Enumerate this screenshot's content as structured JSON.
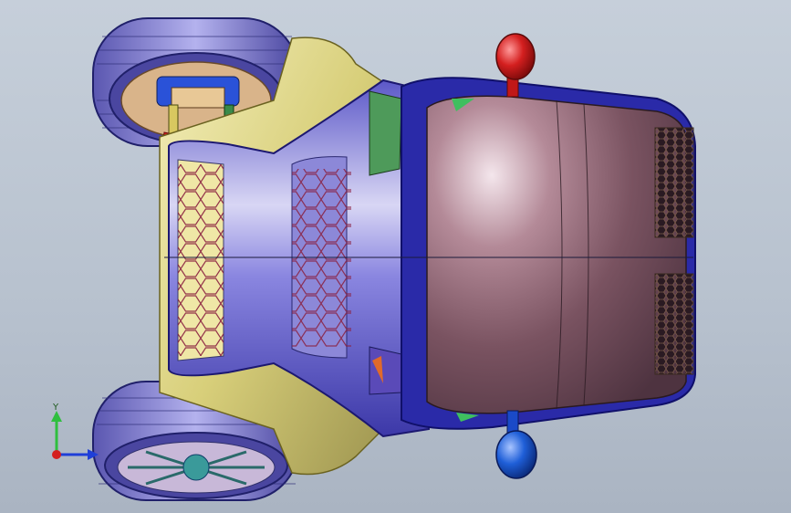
{
  "viewport": {
    "background_top": "#c6cfda",
    "background_bottom": "#aab4c2"
  },
  "model": {
    "body_color": "#6f4a55",
    "shell_color": "#7d78d6",
    "frame_color": "#e4dc8e",
    "tire_color": "#8a86d8",
    "mirror_top_color": "#d41f1f",
    "mirror_bottom_color": "#1f5fd8",
    "accent_green": "#3fbf5f"
  },
  "triad": {
    "y_label": "Y",
    "x_axis_color": "#1f3fd8",
    "y_axis_color": "#2fbf3f",
    "z_axis_color": "#d41f1f"
  }
}
